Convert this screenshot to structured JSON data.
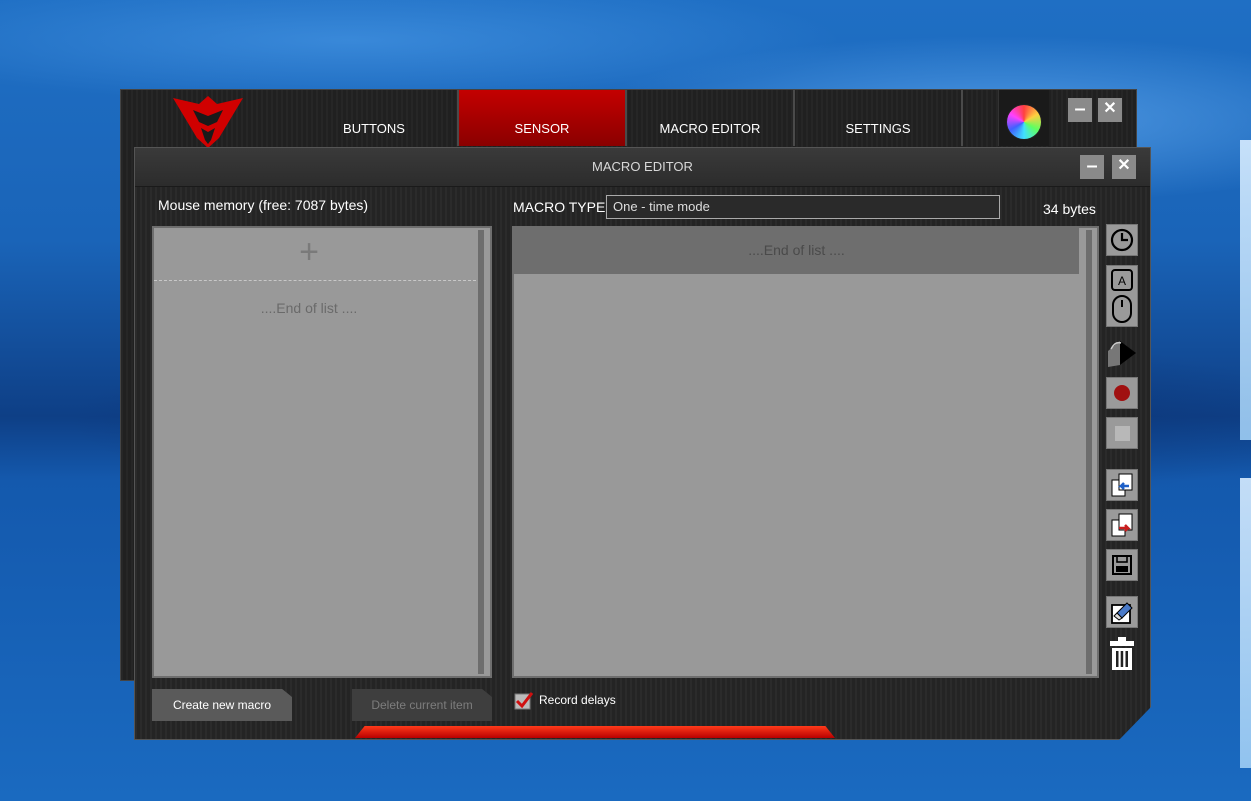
{
  "main_window": {
    "tabs": [
      {
        "label": "BUTTONS",
        "active": false
      },
      {
        "label": "SENSOR",
        "active": true
      },
      {
        "label": "MACRO EDITOR",
        "active": false
      },
      {
        "label": "SETTINGS",
        "active": false
      }
    ],
    "minimize_label": "–",
    "close_label": "✕"
  },
  "dialog": {
    "title": "MACRO EDITOR",
    "minimize_label": "–",
    "close_label": "✕",
    "memory_label": "Mouse memory (free: 7087 bytes)",
    "macro_type_label": "MACRO TYPE",
    "macro_type_value": "One - time mode",
    "bytes_label": "34 bytes",
    "left_list": {
      "add_symbol": "+",
      "end_text": "....End of list ...."
    },
    "right_list": {
      "end_text": "....End of list ...."
    },
    "create_button": "Create new macro",
    "delete_button": "Delete current item",
    "record_delays_label": "Record delays",
    "record_delays_checked": true
  },
  "toolbar": [
    "clock-icon",
    "keyboard-key-icon",
    "mouse-icon",
    "cursor-move-icon",
    "record-icon",
    "stop-icon",
    "import-icon",
    "export-icon",
    "save-icon",
    "eraser-icon",
    "trash-icon"
  ],
  "colors": {
    "accent_red": "#c40000",
    "panel_gray": "#999999",
    "record_red": "#a01010"
  }
}
